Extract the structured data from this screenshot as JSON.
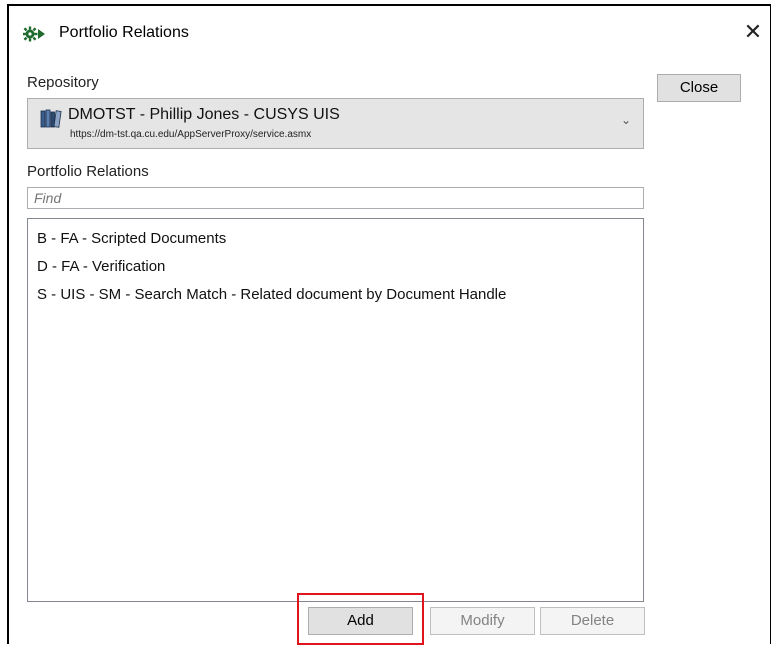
{
  "window": {
    "title": "Portfolio Relations",
    "app_icon": "gear-arrow-icon",
    "close_icon": "close-icon",
    "close_glyph": "✕"
  },
  "repository": {
    "label": "Repository",
    "icon": "book-stack-icon",
    "name": "DMOTST - Phillip Jones - CUSYS UIS",
    "url": "https://dm-tst.qa.cu.edu/AppServerProxy/service.asmx",
    "chevron_icon": "chevron-down-icon",
    "chevron_glyph": "⌄"
  },
  "relations": {
    "label": "Portfolio Relations",
    "find_placeholder": "Find",
    "find_value": "",
    "items": [
      "B - FA - Scripted Documents",
      "D - FA - Verification",
      "S - UIS - SM - Search Match - Related document by Document Handle"
    ]
  },
  "buttons": {
    "close": "Close",
    "add": "Add",
    "modify": "Modify",
    "delete": "Delete"
  },
  "colors": {
    "highlight": "#e0141b",
    "icon_green": "#1f6b2e",
    "disabled_text": "#838383"
  }
}
